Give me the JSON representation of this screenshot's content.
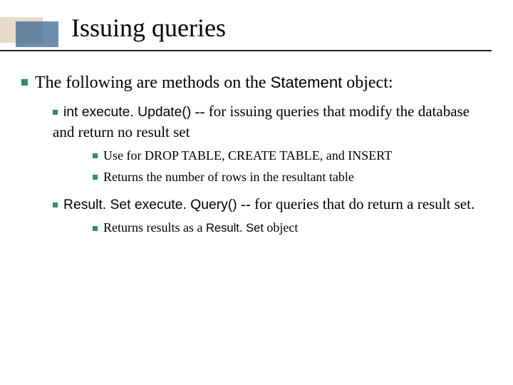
{
  "title": "Issuing queries",
  "lvl1_prefix": "The following are methods on the ",
  "lvl1_code": "Statement",
  "lvl1_suffix": " object:",
  "item1": {
    "code": "int execute. Update()",
    "desc": " -- for issuing queries that modify the database and return no result set",
    "sub1": "Use for  DROP TABLE, CREATE TABLE, and INSERT",
    "sub2": "Returns the number of rows in the resultant table"
  },
  "item2": {
    "code": "Result. Set execute. Query()",
    "desc": " -- for queries that do return a result set.",
    "sub1_prefix": "Returns results as a ",
    "sub1_code": "Result. Set",
    "sub1_suffix": " object"
  }
}
